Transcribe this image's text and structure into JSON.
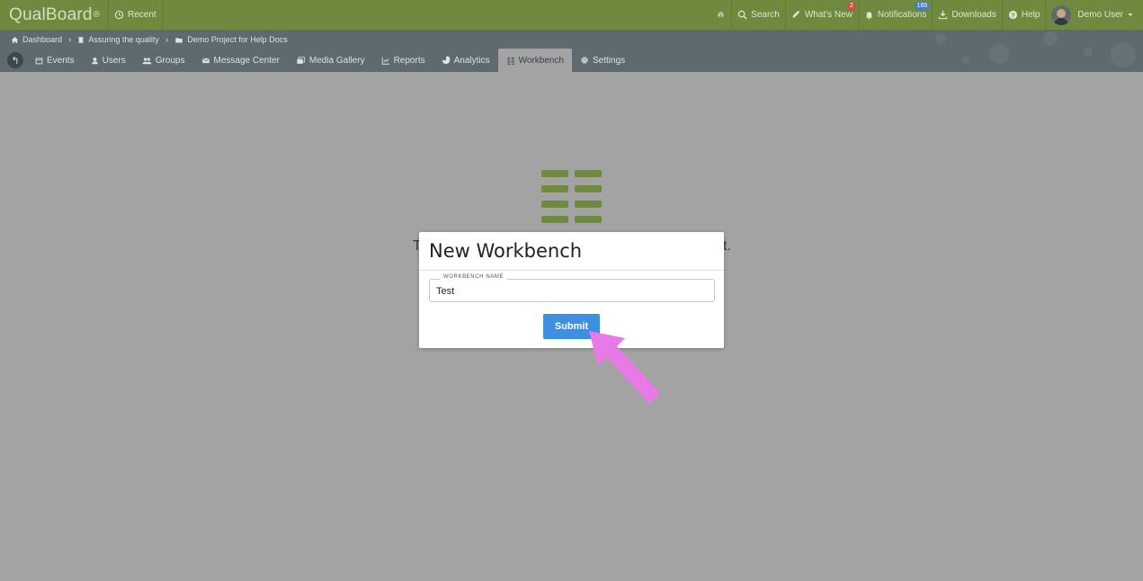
{
  "topbar": {
    "brand": "QualBoard",
    "brand_mark": "®",
    "recent": "Recent",
    "search": "Search",
    "whats_new": "What's New",
    "whats_new_badge": "2",
    "notifications": "Notifications",
    "notifications_badge": "165",
    "downloads": "Downloads",
    "help": "Help",
    "user": "Demo User"
  },
  "breadcrumb": {
    "items": [
      "Dashboard",
      "Assuring the quality",
      "Demo Project for Help Docs"
    ]
  },
  "tabs": [
    {
      "label": "Events",
      "icon": "calendar-icon"
    },
    {
      "label": "Users",
      "icon": "user-icon"
    },
    {
      "label": "Groups",
      "icon": "users-icon"
    },
    {
      "label": "Message Center",
      "icon": "envelope-icon"
    },
    {
      "label": "Media Gallery",
      "icon": "images-icon"
    },
    {
      "label": "Reports",
      "icon": "line-chart-icon"
    },
    {
      "label": "Analytics",
      "icon": "pie-chart-icon"
    },
    {
      "label": "Workbench",
      "icon": "workbench-icon",
      "active": true
    },
    {
      "label": "Settings",
      "icon": "gear-icon"
    }
  ],
  "background": {
    "text_left": "T",
    "text_right": "t."
  },
  "modal": {
    "title": "New Workbench",
    "field_label": "WORKBENCH NAME",
    "field_value": "Test",
    "submit_label": "Submit"
  },
  "colors": {
    "topbar": "#6f8a3e",
    "subnav": "#5d6a6f",
    "overlay": "#a3a3a3",
    "submit": "#3d8fe0",
    "arrow": "#e879e6"
  }
}
